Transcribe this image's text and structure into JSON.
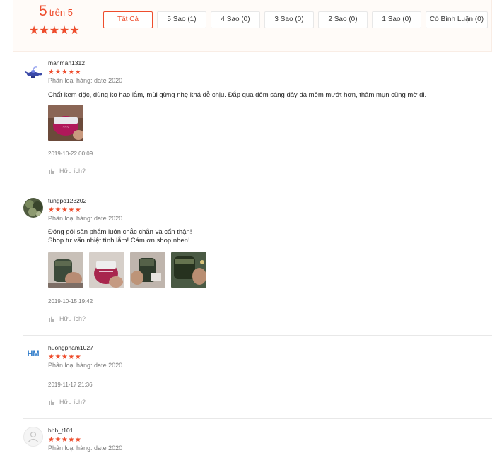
{
  "summary": {
    "rating": "5",
    "rating_suffix": "trên 5",
    "stars": "★★★★★",
    "filters": [
      {
        "label": "Tất Cả",
        "active": true
      },
      {
        "label": "5 Sao (1)"
      },
      {
        "label": "4 Sao (0)"
      },
      {
        "label": "3 Sao (0)"
      },
      {
        "label": "2 Sao (0)"
      },
      {
        "label": "1 Sao (0)"
      },
      {
        "label": "Có Bình Luận (0)"
      }
    ]
  },
  "reviews": [
    {
      "username": "manman1312",
      "stars": "★★★★★",
      "variation": "Phân loại hàng: date 2020",
      "comment": "Chất kem đặc, dùng ko hao lắm, mùi gừng nhẹ khá dễ chịu. Đắp qua đêm sáng dây da mềm mướt hơn, thâm mụn cũng mờ đi.",
      "date": "2019-10-22 00:09",
      "helpful": "Hữu ích?",
      "avatar_icon": "genie-lamp-icon"
    },
    {
      "username": "tungpo123202",
      "stars": "★★★★★",
      "variation": "Phân loại hàng: date 2020",
      "comment_line1": "Đóng gói sản phẩm luôn chắc chắn và cẩn thận!",
      "comment_line2": "Shop tư vấn nhiệt tình lắm! Cám ơn shop nhen!",
      "date": "2019-10-15 19:42",
      "helpful": "Hữu ích?",
      "avatar_icon": "photo-avatar-icon"
    },
    {
      "username": "huongpham1027",
      "stars": "★★★★★",
      "variation": "Phân loại hàng: date 2020",
      "date": "2019-11-17 21:36",
      "helpful": "Hữu ích?",
      "avatar_icon": "hm-logo-icon",
      "avatar_text": "HM"
    },
    {
      "username": "hhh_t101",
      "stars": "★★★★★",
      "variation": "Phân loại hàng: date 2020",
      "avatar_icon": "default-user-icon"
    }
  ],
  "colors": {
    "accent": "#ee4d2d",
    "summary_bg": "#fffbf8"
  }
}
